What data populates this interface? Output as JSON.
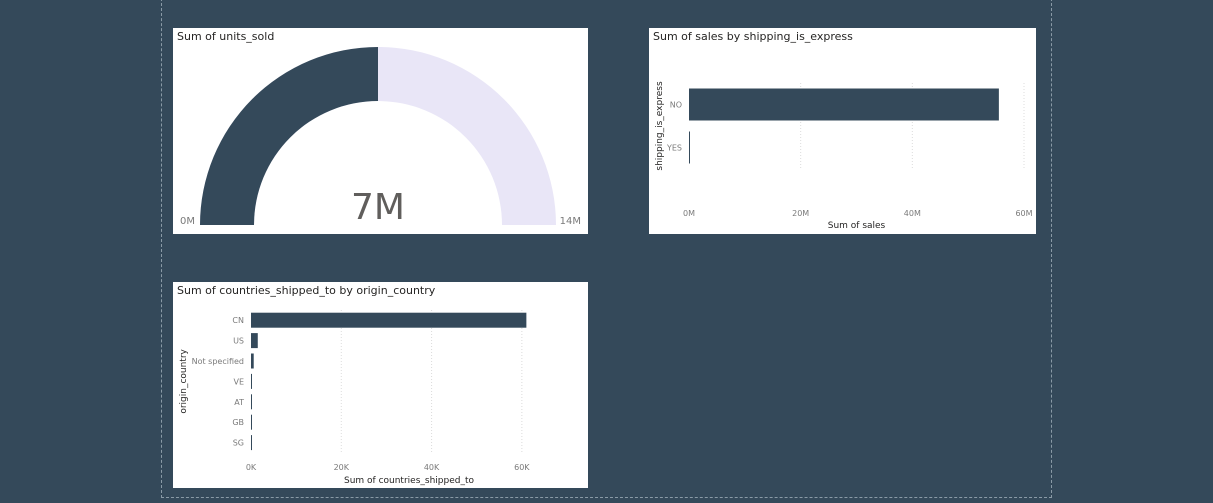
{
  "colors": {
    "background": "#34495a",
    "accent": "#34495a",
    "gauge_remaining": "#e9e6f7",
    "gridline": "#dcdcdc",
    "text_muted": "#7a7a7a",
    "text_dark": "#252423"
  },
  "chart_data": [
    {
      "type": "gauge",
      "title": "Sum of units_sold",
      "value": 7,
      "value_label": "7M",
      "min": 0,
      "max": 14,
      "min_label": "0M",
      "max_label": "14M",
      "units": "M"
    },
    {
      "type": "bar",
      "orientation": "horizontal",
      "title": "Sum of sales by shipping_is_express",
      "categories": [
        "NO",
        "YES"
      ],
      "values": [
        55.5,
        0.1
      ],
      "units": "M",
      "xlabel": "Sum of sales",
      "ylabel": "shipping_is_express",
      "xlim": [
        0,
        60
      ],
      "xticks": [
        0,
        20,
        40,
        60
      ],
      "xtick_labels": [
        "0M",
        "20M",
        "40M",
        "60M"
      ],
      "grid": true
    },
    {
      "type": "bar",
      "orientation": "horizontal",
      "title": "Sum of countries_shipped_to by origin_country",
      "categories": [
        "CN",
        "US",
        "Not specified",
        "VE",
        "AT",
        "GB",
        "SG"
      ],
      "values": [
        61,
        1.5,
        0.6,
        0.1,
        0.05,
        0.05,
        0.05
      ],
      "units": "K",
      "xlabel": "Sum of countries_shipped_to",
      "ylabel": "origin_country",
      "xlim": [
        0,
        70
      ],
      "xticks": [
        0,
        20,
        40,
        60
      ],
      "xtick_labels": [
        "0K",
        "20K",
        "40K",
        "60K"
      ],
      "grid": true
    }
  ]
}
